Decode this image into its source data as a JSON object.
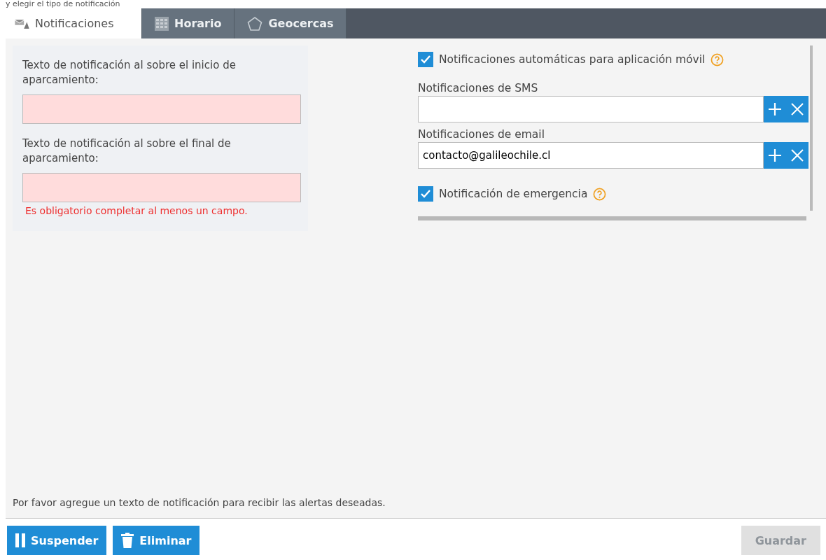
{
  "header_text": "y elegir el tipo de notificación",
  "tabs": [
    {
      "label": "Notificaciones",
      "selected": true
    },
    {
      "label": "Horario",
      "selected": false
    },
    {
      "label": "Geocercas",
      "selected": false
    }
  ],
  "text_fields": [
    {
      "label": "Texto de notificación al sobre el inicio de aparcamiento:",
      "invalid": true
    },
    {
      "label": "Texto de notificación al sobre el final de aparcamiento:",
      "invalid": true
    }
  ],
  "error_message": "Es obligatorio completar al menos un campo.",
  "options": [
    {
      "kind": "checkbox",
      "label": "Notificaciones automáticas para aplicación móvil",
      "checked": true
    },
    {
      "kind": "list",
      "label": "Notificaciones de SMS"
    },
    {
      "kind": "list",
      "label": "Notificaciones de email",
      "value": "contacto@galileochile.cl"
    },
    {
      "kind": "checkbox",
      "label": "Notificación de emergencia",
      "checked": true
    }
  ],
  "hint": "Por favor agregue un texto de notificación para recibir las alertas deseadas.",
  "buttons": [
    {
      "label": "Suspender",
      "disabled": false
    },
    {
      "label": "Eliminar",
      "disabled": false
    }
  ],
  "save_button": {
    "label": "Guardar",
    "disabled": true
  }
}
